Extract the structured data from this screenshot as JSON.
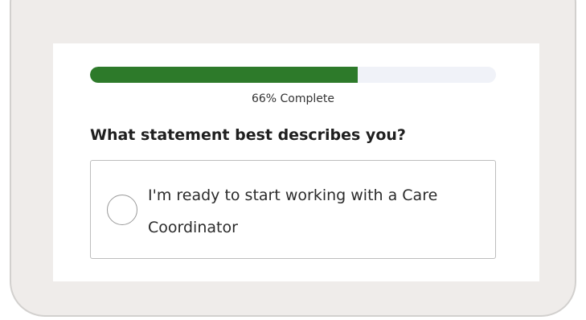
{
  "progress": {
    "percent": 66,
    "label": "66% Complete",
    "fill_color": "#2d7a2a",
    "track_color": "#f0f2f8"
  },
  "question": {
    "title": "What statement best describes you?"
  },
  "options": [
    {
      "label": "I'm ready to start working with a Care Coordinator",
      "selected": false
    }
  ],
  "colors": {
    "frame_background": "#efecea",
    "card_background": "#ffffff",
    "option_border": "#bdbdbd"
  }
}
